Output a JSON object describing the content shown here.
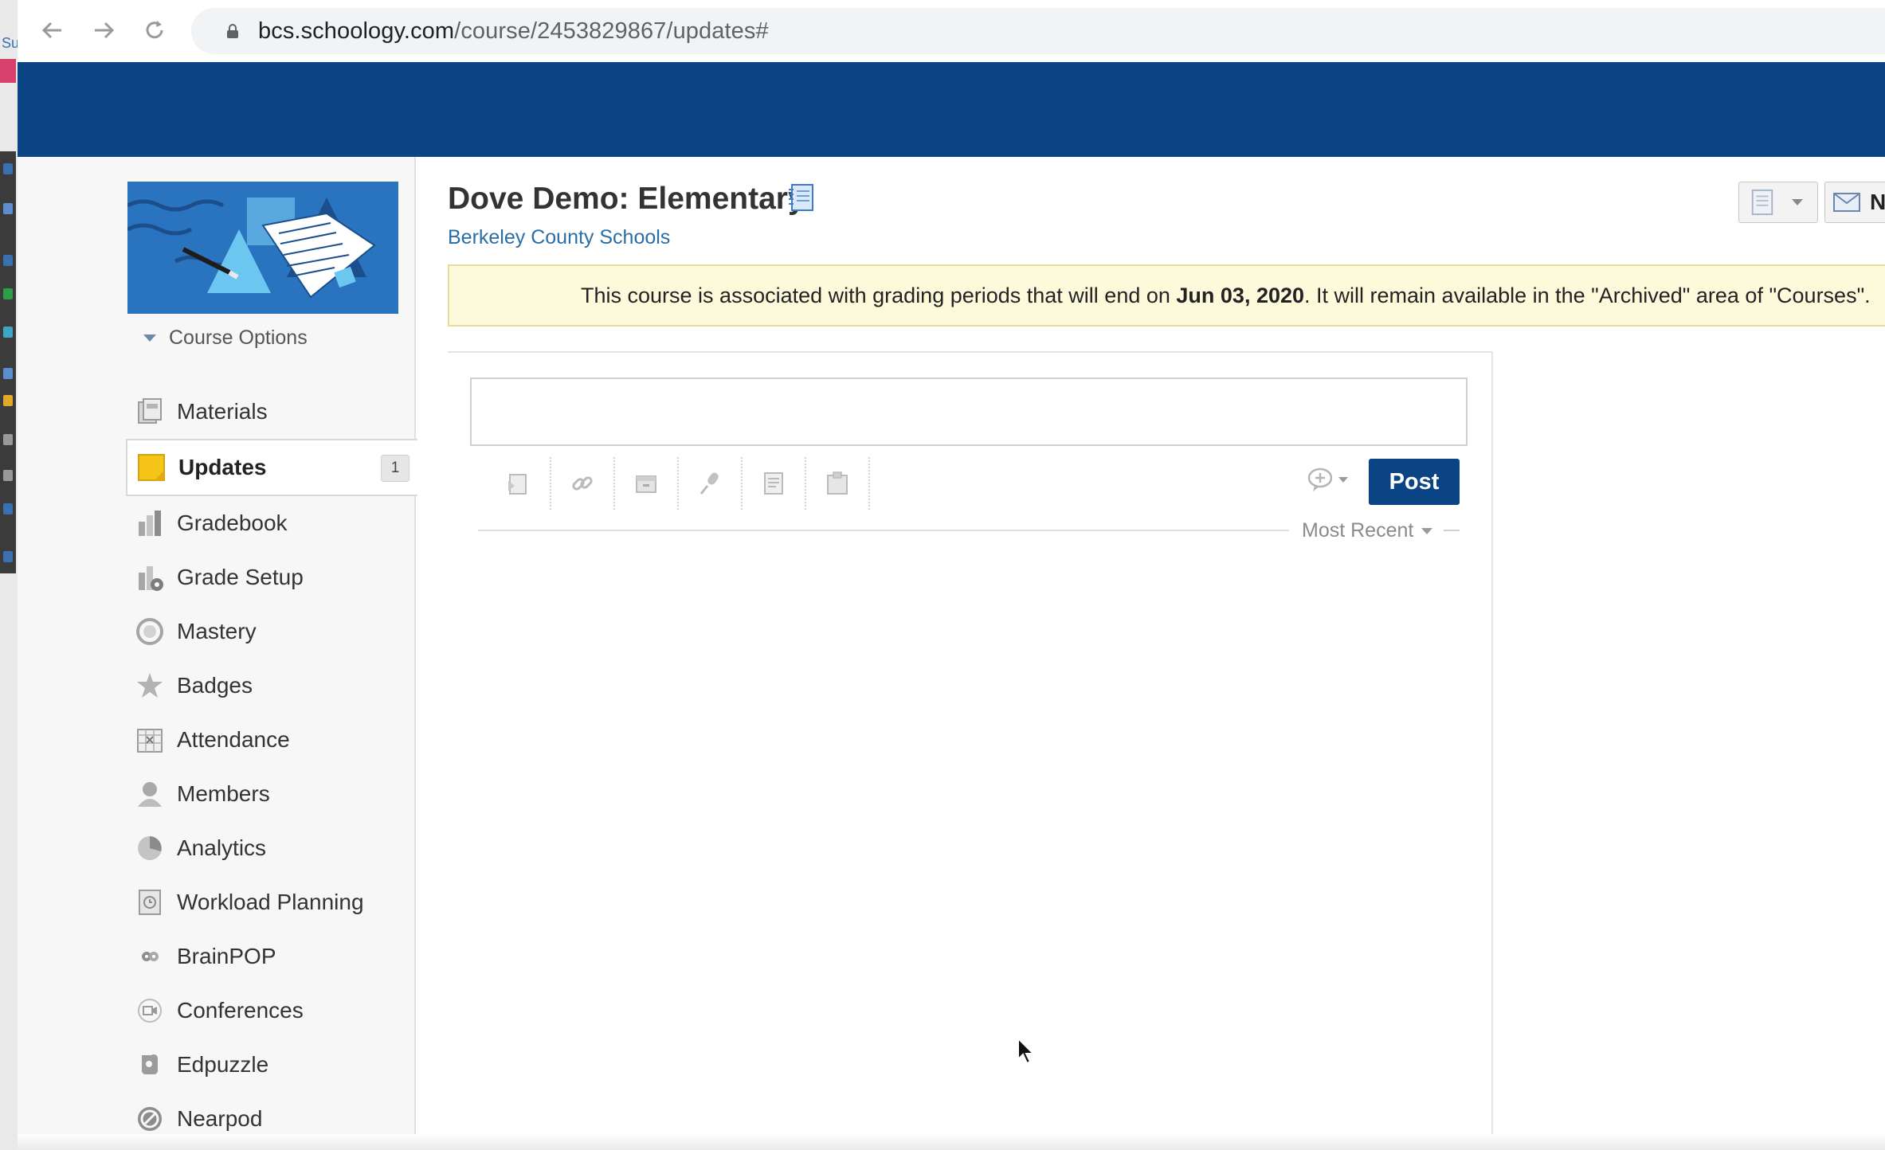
{
  "os_strip": {
    "label": "Su"
  },
  "browser": {
    "url_host": "bcs.schoology.com",
    "url_path": "/course/2453829867/updates#"
  },
  "course": {
    "title": "Dove Demo: Elementary",
    "school": "Berkeley County Schools",
    "options_label": "Course Options"
  },
  "nav": {
    "items": [
      {
        "label": "Materials",
        "icon": "materials-icon"
      },
      {
        "label": "Updates",
        "icon": "updates-icon",
        "active": true,
        "badge": "1"
      },
      {
        "label": "Gradebook",
        "icon": "gradebook-icon"
      },
      {
        "label": "Grade Setup",
        "icon": "grade-setup-icon"
      },
      {
        "label": "Mastery",
        "icon": "mastery-icon"
      },
      {
        "label": "Badges",
        "icon": "badges-icon"
      },
      {
        "label": "Attendance",
        "icon": "attendance-icon"
      },
      {
        "label": "Members",
        "icon": "members-icon"
      },
      {
        "label": "Analytics",
        "icon": "analytics-icon"
      },
      {
        "label": "Workload Planning",
        "icon": "workload-planning-icon"
      },
      {
        "label": "BrainPOP",
        "icon": "brainpop-icon"
      },
      {
        "label": "Conferences",
        "icon": "conferences-icon"
      },
      {
        "label": "Edpuzzle",
        "icon": "edpuzzle-icon"
      },
      {
        "label": "Nearpod",
        "icon": "nearpod-icon"
      }
    ]
  },
  "notice": {
    "before": "This course is associated with grading periods that will end on ",
    "date": "Jun 03, 2020",
    "after": ". It will remain available in the \"Archived\" area of \"Courses\"."
  },
  "composer": {
    "post_label": "Post",
    "sort_label": "Most Recent"
  },
  "top_right": {
    "message_letter": "N"
  },
  "colors": {
    "brand_blue": "#0b4485",
    "link_blue": "#2a6ea6",
    "notice_bg": "#fdfadc",
    "updates_icon": "#f5c518"
  }
}
